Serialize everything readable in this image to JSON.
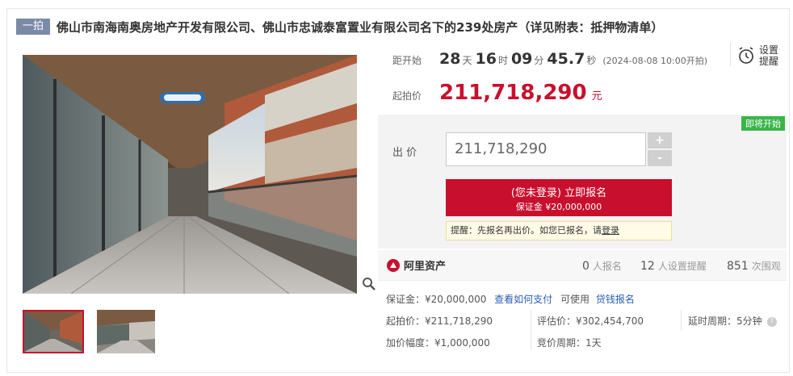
{
  "header": {
    "badge": "一拍",
    "title": "佛山市南海南奥房地产开发有限公司、佛山市忠诚泰富置业有限公司名下的239处房产（详见附表：抵押物清单）"
  },
  "countdown": {
    "label": "距开始",
    "days": "28",
    "days_unit": "天",
    "hours": "16",
    "hours_unit": "时",
    "minutes": "09",
    "minutes_unit": "分",
    "seconds": "45.7",
    "seconds_unit": "秒",
    "start_time": "(2024-08-08 10:00开拍)"
  },
  "remind": {
    "label_line1": "设置",
    "label_line2": "提醒"
  },
  "start_price": {
    "label": "起拍价",
    "value": "211,718,290",
    "unit": "元"
  },
  "bid": {
    "status_tag": "即将开始",
    "label": "出 价",
    "input_value": "211,718,290",
    "plus": "+",
    "minus": "-",
    "signup_main": "(您未登录) 立即报名",
    "signup_sub": "保证金 ¥20,000,000",
    "tip_text": "提醒：先报名再出价。如您已报名，请",
    "tip_link": "登录"
  },
  "stats": {
    "brand": "阿里资产",
    "signups": "0",
    "signups_label": "人报名",
    "reminders": "12",
    "reminders_label": "人设置提醒",
    "views": "851",
    "views_label": "次围观"
  },
  "info": {
    "deposit": "保证金：¥20,000,000",
    "how_to_pay": "查看如何支付",
    "available": "可使用",
    "loan_signup": "贷钱报名",
    "start_price": "起拍价：¥211,718,290",
    "valuation": "评估价：¥302,454,700",
    "extension": "延时周期：5分钟",
    "increment": "加价幅度：¥1,000,000",
    "cycle": "竞价周期：1天"
  },
  "colors": {
    "accent_red": "#c8102e",
    "link_blue": "#2a5db0",
    "status_green": "#3ab54a",
    "badge_gray": "#7b8aa6"
  }
}
